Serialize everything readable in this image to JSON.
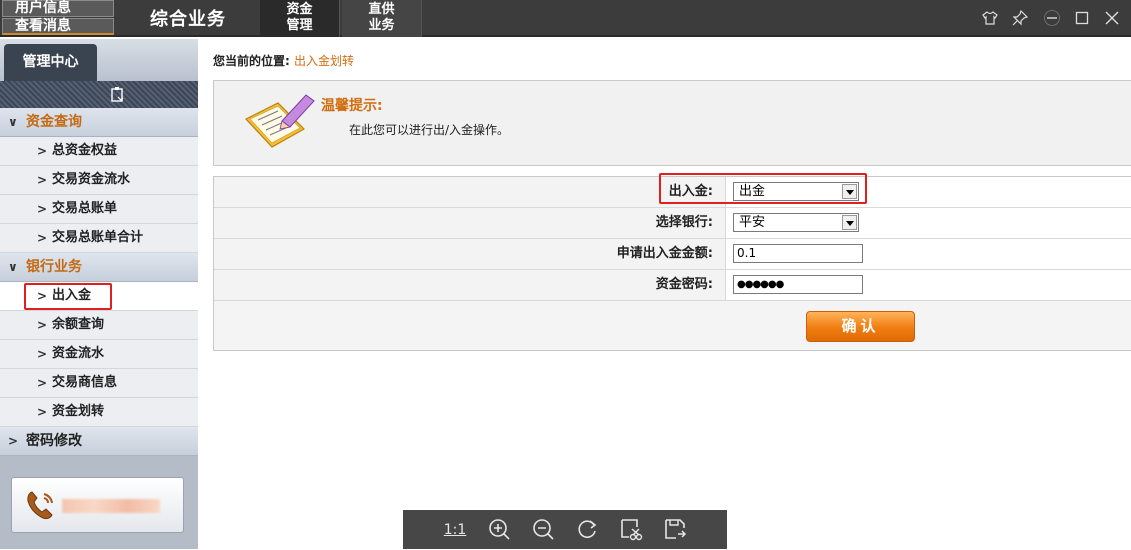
{
  "topbar": {
    "user_info": "用户信息",
    "view_messages": "查看消息",
    "app_title": "综合业务",
    "tabs": [
      {
        "line1": "资金",
        "line2": "管理"
      },
      {
        "line1": "直供",
        "line2": "业务"
      }
    ],
    "window_controls": [
      "shirt-icon",
      "pin-icon",
      "minimize-icon",
      "maximize-icon",
      "close-icon"
    ]
  },
  "sidebar": {
    "tab_label": "管理中心",
    "groups": [
      {
        "label": "资金查询",
        "expanded": true,
        "items": [
          "总资金权益",
          "交易资金流水",
          "交易总账单",
          "交易总账单合计"
        ]
      },
      {
        "label": "银行业务",
        "expanded": true,
        "items": [
          "出入金",
          "余额查询",
          "资金流水",
          "交易商信息",
          "资金划转"
        ]
      },
      {
        "label": "密码修改",
        "expanded": false,
        "items": []
      }
    ],
    "selected_item": "出入金"
  },
  "main": {
    "breadcrumb_prefix": "您当前的位置:",
    "breadcrumb_current": "出入金划转",
    "tip_title": "温馨提示:",
    "tip_text": "在此您可以进行出/入金操作。",
    "form": {
      "direction_label": "出入金:",
      "direction_value": "出金",
      "bank_label": "选择银行:",
      "bank_value": "平安",
      "amount_label": "申请出入金金额:",
      "amount_value": "0.1",
      "password_label": "资金密码:",
      "password_value": "●●●●●●",
      "confirm_label": "确认"
    }
  },
  "image_toolbar": {
    "actual_size": "1:1",
    "tools": [
      "zoom-in-icon",
      "zoom-out-icon",
      "rotate-icon",
      "crop-icon",
      "save-icon"
    ]
  },
  "colors": {
    "accent_orange": "#d06e10",
    "highlight_red": "#e02020",
    "topbar_bg": "#3c3c3c",
    "button_orange": "#f07d10"
  }
}
